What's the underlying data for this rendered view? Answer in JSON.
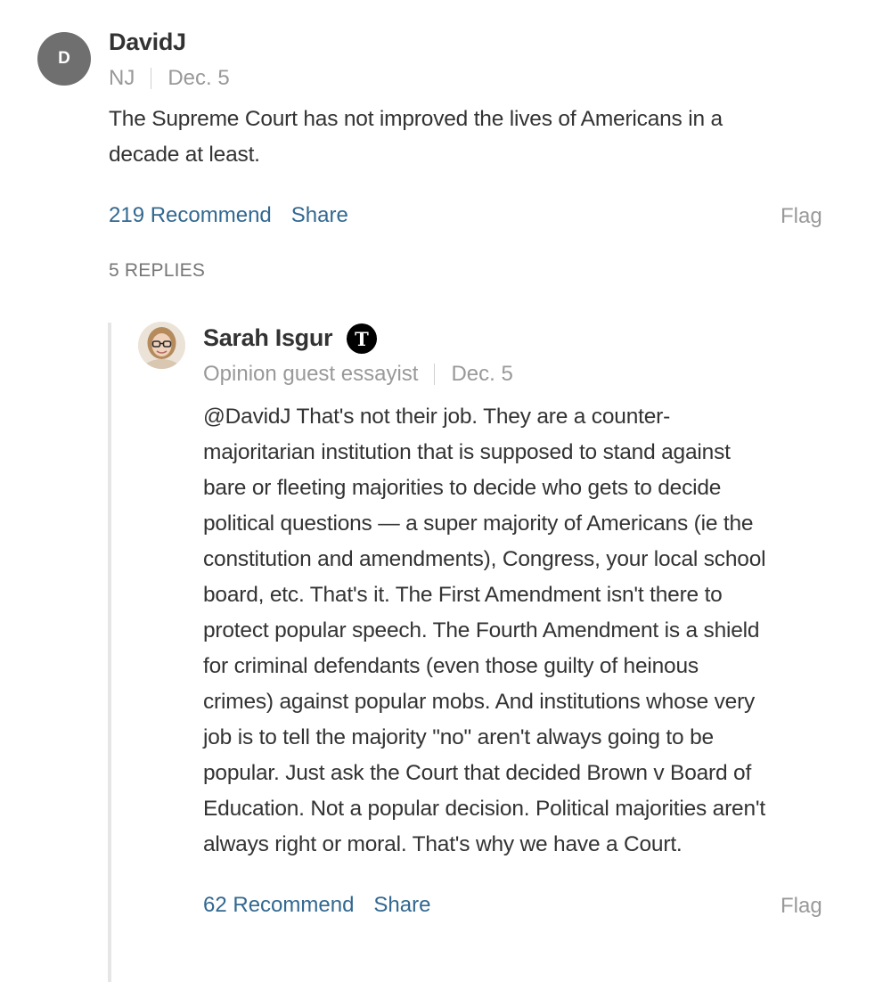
{
  "comment": {
    "avatar_initial": "D",
    "author": "DavidJ",
    "location": "NJ",
    "date": "Dec. 5",
    "lines": [
      "The Supreme Court has not improved the lives of Americans in a",
      "decade at least."
    ],
    "recommend_label": "219 Recommend",
    "share_label": "Share",
    "flag_label": "Flag",
    "replies_label": "5 REPLIES"
  },
  "reply": {
    "author": "Sarah Isgur",
    "badge_glyph": "T",
    "role": "Opinion guest essayist",
    "date": "Dec. 5",
    "lines": [
      "@DavidJ  That's not their job. They are a counter-",
      "majoritarian institution that is supposed to stand against",
      "bare or fleeting majorities to decide who gets to decide",
      "political questions — a super majority of Americans (ie the",
      "constitution and amendments), Congress, your local school",
      "board, etc. That's it. The First Amendment isn't there to",
      "protect popular speech. The Fourth Amendment is a shield",
      "for criminal defendants (even those guilty of heinous",
      "crimes) against popular mobs. And institutions whose very",
      "job is to tell the majority \"no\" aren't always going to be",
      "popular. Just ask the Court that decided Brown v Board of",
      "Education. Not a popular decision. Political majorities aren't",
      "always right or moral. That's why we have a Court."
    ],
    "recommend_label": "62 Recommend",
    "share_label": "Share",
    "flag_label": "Flag"
  },
  "icons": {
    "avatar_photo": "person-avatar-icon",
    "badge": "nyt-logo-badge-icon"
  },
  "colors": {
    "link": "#326891",
    "muted": "#999999",
    "text": "#333333",
    "avatar_bg": "#6f6f6f",
    "thread_line": "#e6e6e6"
  }
}
